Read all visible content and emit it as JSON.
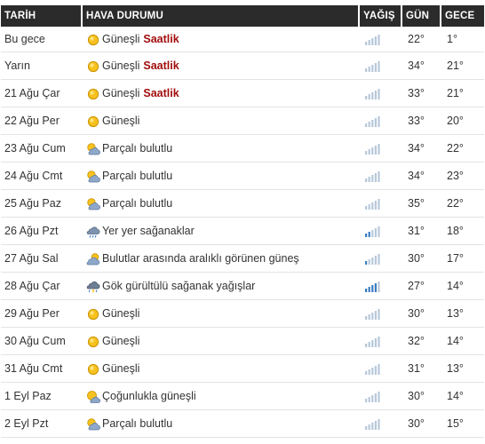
{
  "header": {
    "date": "TARİH",
    "weather": "HAVA DURUMU",
    "rain": "YAĞIŞ",
    "day": "GÜN",
    "night": "GECE"
  },
  "hourly_label": "Saatlik",
  "colors": {
    "header_bg": "#2b2b2b",
    "hourly_link": "#a10d0d",
    "rain_bar_active": "#3b7dc4",
    "rain_bar_inactive": "#b7c8da"
  },
  "rows": [
    {
      "date": "Bu gece",
      "icon": "sun-icon",
      "condition": "Güneşli",
      "hourly": true,
      "rain_level": 0,
      "day": "22°",
      "night": "1°"
    },
    {
      "date": "Yarın",
      "icon": "sun-icon",
      "condition": "Güneşli",
      "hourly": true,
      "rain_level": 0,
      "day": "34°",
      "night": "21°"
    },
    {
      "date": "21 Ağu Çar",
      "icon": "sun-icon",
      "condition": "Güneşli",
      "hourly": true,
      "rain_level": 0,
      "day": "33°",
      "night": "21°"
    },
    {
      "date": "22 Ağu Per",
      "icon": "sun-icon",
      "condition": "Güneşli",
      "hourly": false,
      "rain_level": 0,
      "day": "33°",
      "night": "20°"
    },
    {
      "date": "23 Ağu Cum",
      "icon": "partly-cloudy-icon",
      "condition": "Parçalı bulutlu",
      "hourly": false,
      "rain_level": 0,
      "day": "34°",
      "night": "22°"
    },
    {
      "date": "24 Ağu Cmt",
      "icon": "partly-cloudy-icon",
      "condition": "Parçalı bulutlu",
      "hourly": false,
      "rain_level": 0,
      "day": "34°",
      "night": "23°"
    },
    {
      "date": "25 Ağu Paz",
      "icon": "partly-cloudy-icon",
      "condition": "Parçalı bulutlu",
      "hourly": false,
      "rain_level": 0,
      "day": "35°",
      "night": "22°"
    },
    {
      "date": "26 Ağu Pzt",
      "icon": "showers-icon",
      "condition": "Yer yer sağanaklar",
      "hourly": false,
      "rain_level": 2,
      "day": "31°",
      "night": "18°"
    },
    {
      "date": "27 Ağu Sal",
      "icon": "sun-behind-cloud-icon",
      "condition": "Bulutlar arasında aralıklı görünen güneş",
      "hourly": false,
      "rain_level": 1,
      "day": "30°",
      "night": "17°"
    },
    {
      "date": "28 Ağu Çar",
      "icon": "thunderstorm-icon",
      "condition": "Gök gürültülü sağanak yağışlar",
      "hourly": false,
      "rain_level": 4,
      "day": "27°",
      "night": "14°"
    },
    {
      "date": "29 Ağu Per",
      "icon": "sun-icon",
      "condition": "Güneşli",
      "hourly": false,
      "rain_level": 0,
      "day": "30°",
      "night": "13°"
    },
    {
      "date": "30 Ağu Cum",
      "icon": "sun-icon",
      "condition": "Güneşli",
      "hourly": false,
      "rain_level": 0,
      "day": "32°",
      "night": "14°"
    },
    {
      "date": "31 Ağu Cmt",
      "icon": "sun-icon",
      "condition": "Güneşli",
      "hourly": false,
      "rain_level": 0,
      "day": "31°",
      "night": "13°"
    },
    {
      "date": "1 Eyl Paz",
      "icon": "mostly-sunny-icon",
      "condition": "Çoğunlukla güneşli",
      "hourly": false,
      "rain_level": 0,
      "day": "30°",
      "night": "14°"
    },
    {
      "date": "2 Eyl Pzt",
      "icon": "partly-cloudy-icon",
      "condition": "Parçalı bulutlu",
      "hourly": false,
      "rain_level": 0,
      "day": "30°",
      "night": "15°"
    }
  ]
}
